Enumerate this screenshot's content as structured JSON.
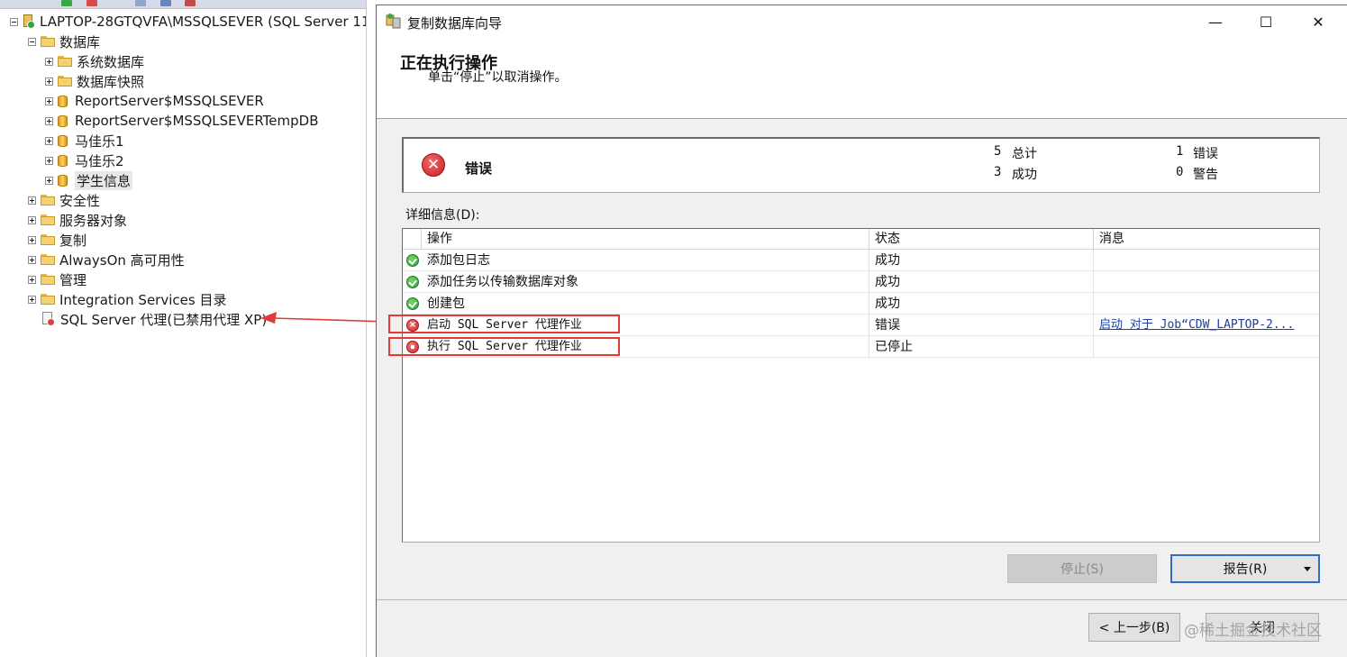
{
  "explorer": {
    "server_node": "LAPTOP-28GTQVFA\\MSSQLSEVER (SQL Server 11",
    "databases_node": "数据库",
    "db_items": [
      "系统数据库",
      "数据库快照",
      "ReportServer$MSSQLSEVER",
      "ReportServer$MSSQLSEVERTempDB",
      "马佳乐1",
      "马佳乐2",
      "学生信息"
    ],
    "folders": [
      "安全性",
      "服务器对象",
      "复制",
      "AlwaysOn 高可用性",
      "管理",
      "Integration Services 目录"
    ],
    "agent_node": "SQL Server 代理(已禁用代理 XP)"
  },
  "wizard": {
    "title": "复制数据库向导",
    "window_buttons": {
      "minimize": "—",
      "maximize": "☐",
      "close": "✕"
    },
    "heading": "正在执行操作",
    "subheading": "单击“停止”以取消操作。",
    "summary": {
      "status": "错误",
      "total_count": "5",
      "total_label": "总计",
      "success_count": "3",
      "success_label": "成功",
      "error_count": "1",
      "error_label": "错误",
      "warning_count": "0",
      "warning_label": "警告"
    },
    "details_label": "详细信息(D):",
    "columns": [
      "操作",
      "状态",
      "消息"
    ],
    "rows": [
      {
        "action": "添加包日志",
        "status": "成功",
        "message": "",
        "icon": "success-icon"
      },
      {
        "action": "添加任务以传输数据库对象",
        "status": "成功",
        "message": "",
        "icon": "success-icon"
      },
      {
        "action": "创建包",
        "status": "成功",
        "message": "",
        "icon": "success-icon"
      },
      {
        "action": "启动 SQL Server 代理作业",
        "status": "错误",
        "message": "启动 对于 Job“CDW_LAPTOP-2...",
        "icon": "error-icon"
      },
      {
        "action": "执行 SQL Server 代理作业",
        "status": "已停止",
        "message": "",
        "icon": "stopped-icon"
      }
    ],
    "buttons": {
      "stop": "停止(S)",
      "report": "报告(R)",
      "previous": "< 上一步(B)",
      "close": "关闭"
    },
    "watermark": "@稀土掘金技术社区"
  },
  "colors": {
    "annotation_red": "#e03a3a",
    "error_red": "#cc2a2a",
    "success_green": "#2d9e33",
    "link_blue": "#1a3fa8"
  }
}
